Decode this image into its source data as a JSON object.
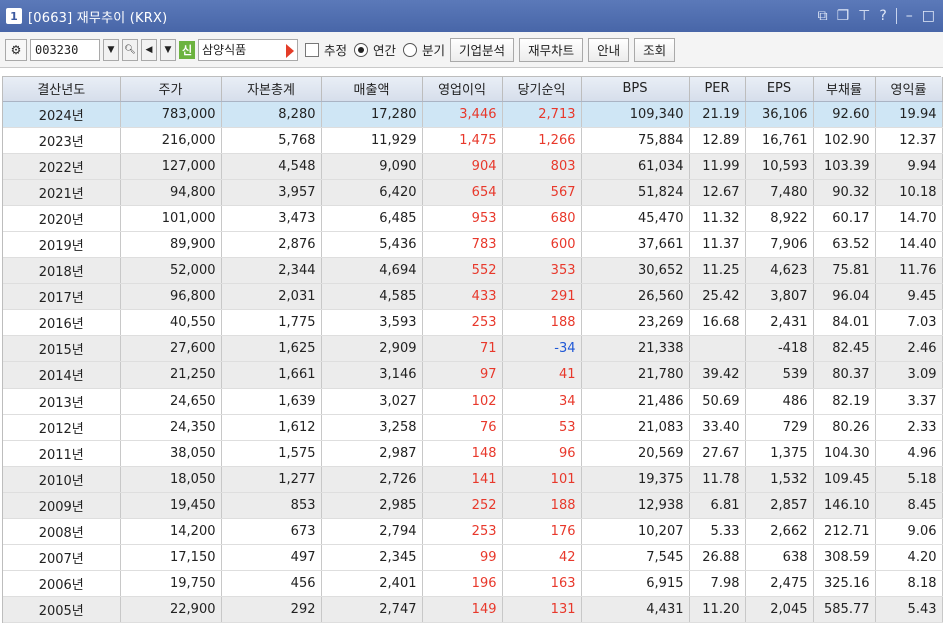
{
  "window": {
    "number": "1",
    "title": "[0663] 재무추이 (KRX)",
    "controls": [
      "restore-icon",
      "popout-icon",
      "pin-icon",
      "help-icon",
      "minimize-icon",
      "maximize-icon"
    ]
  },
  "toolbar": {
    "stock_code": "003230",
    "market_badge": "신",
    "stock_name": "삼양식품",
    "estimate_label": "추정",
    "annual_label": "연간",
    "quarter_label": "분기",
    "period_selected": "연간",
    "buttons": [
      "기업분석",
      "재무차트",
      "안내",
      "조회"
    ]
  },
  "table": {
    "columns": [
      "결산년도",
      "주가",
      "자본총계",
      "매출액",
      "영업이익",
      "당기순익",
      "BPS",
      "PER",
      "EPS",
      "부채률",
      "영익률"
    ],
    "rows": [
      [
        "2024년",
        "783,000",
        "8,280",
        "17,280",
        "3,446",
        "2,713",
        "109,340",
        "21.19",
        "36,106",
        "92.60",
        "19.94"
      ],
      [
        "2023년",
        "216,000",
        "5,768",
        "11,929",
        "1,475",
        "1,266",
        "75,884",
        "12.89",
        "16,761",
        "102.90",
        "12.37"
      ],
      [
        "2022년",
        "127,000",
        "4,548",
        "9,090",
        "904",
        "803",
        "61,034",
        "11.99",
        "10,593",
        "103.39",
        "9.94"
      ],
      [
        "2021년",
        "94,800",
        "3,957",
        "6,420",
        "654",
        "567",
        "51,824",
        "12.67",
        "7,480",
        "90.32",
        "10.18"
      ],
      [
        "2020년",
        "101,000",
        "3,473",
        "6,485",
        "953",
        "680",
        "45,470",
        "11.32",
        "8,922",
        "60.17",
        "14.70"
      ],
      [
        "2019년",
        "89,900",
        "2,876",
        "5,436",
        "783",
        "600",
        "37,661",
        "11.37",
        "7,906",
        "63.52",
        "14.40"
      ],
      [
        "2018년",
        "52,000",
        "2,344",
        "4,694",
        "552",
        "353",
        "30,652",
        "11.25",
        "4,623",
        "75.81",
        "11.76"
      ],
      [
        "2017년",
        "96,800",
        "2,031",
        "4,585",
        "433",
        "291",
        "26,560",
        "25.42",
        "3,807",
        "96.04",
        "9.45"
      ],
      [
        "2016년",
        "40,550",
        "1,775",
        "3,593",
        "253",
        "188",
        "23,269",
        "16.68",
        "2,431",
        "84.01",
        "7.03"
      ],
      [
        "2015년",
        "27,600",
        "1,625",
        "2,909",
        "71",
        "-34",
        "21,338",
        "",
        "-418",
        "82.45",
        "2.46"
      ],
      [
        "2014년",
        "21,250",
        "1,661",
        "3,146",
        "97",
        "41",
        "21,780",
        "39.42",
        "539",
        "80.37",
        "3.09"
      ],
      [
        "2013년",
        "24,650",
        "1,639",
        "3,027",
        "102",
        "34",
        "21,486",
        "50.69",
        "486",
        "82.19",
        "3.37"
      ],
      [
        "2012년",
        "24,350",
        "1,612",
        "3,258",
        "76",
        "53",
        "21,083",
        "33.40",
        "729",
        "80.26",
        "2.33"
      ],
      [
        "2011년",
        "38,050",
        "1,575",
        "2,987",
        "148",
        "96",
        "20,569",
        "27.67",
        "1,375",
        "104.30",
        "4.96"
      ],
      [
        "2010년",
        "18,050",
        "1,277",
        "2,726",
        "141",
        "101",
        "19,375",
        "11.78",
        "1,532",
        "109.45",
        "5.18"
      ],
      [
        "2009년",
        "19,450",
        "853",
        "2,985",
        "252",
        "188",
        "12,938",
        "6.81",
        "2,857",
        "146.10",
        "8.45"
      ],
      [
        "2008년",
        "14,200",
        "673",
        "2,794",
        "253",
        "176",
        "10,207",
        "5.33",
        "2,662",
        "212.71",
        "9.06"
      ],
      [
        "2007년",
        "17,150",
        "497",
        "2,345",
        "99",
        "42",
        "7,545",
        "26.88",
        "638",
        "308.59",
        "4.20"
      ],
      [
        "2006년",
        "19,750",
        "456",
        "2,401",
        "196",
        "163",
        "6,915",
        "7.98",
        "2,475",
        "325.16",
        "8.18"
      ],
      [
        "2005년",
        "22,900",
        "292",
        "2,747",
        "149",
        "131",
        "4,431",
        "11.20",
        "2,045",
        "585.77",
        "5.43"
      ]
    ]
  },
  "colors": {
    "positive": "#e8382b",
    "negative": "#1f58d6",
    "selected_row": "#cfe6f5",
    "alt_row": "#ececec",
    "titlebar": "#4f6daf"
  }
}
